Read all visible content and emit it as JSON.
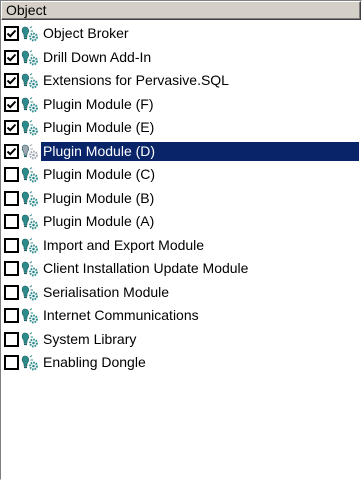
{
  "header": {
    "title": "Object"
  },
  "items": [
    {
      "label": "Object Broker",
      "checked": true,
      "selected": false
    },
    {
      "label": "Drill Down Add-In",
      "checked": true,
      "selected": false
    },
    {
      "label": "Extensions for Pervasive.SQL",
      "checked": true,
      "selected": false
    },
    {
      "label": "Plugin Module (F)",
      "checked": true,
      "selected": false
    },
    {
      "label": "Plugin Module (E)",
      "checked": true,
      "selected": false
    },
    {
      "label": "Plugin Module (D)",
      "checked": true,
      "selected": true
    },
    {
      "label": "Plugin Module (C)",
      "checked": false,
      "selected": false
    },
    {
      "label": "Plugin Module (B)",
      "checked": false,
      "selected": false
    },
    {
      "label": "Plugin Module (A)",
      "checked": false,
      "selected": false
    },
    {
      "label": "Import and Export Module",
      "checked": false,
      "selected": false
    },
    {
      "label": "Client Installation Update Module",
      "checked": false,
      "selected": false
    },
    {
      "label": "Serialisation Module",
      "checked": false,
      "selected": false
    },
    {
      "label": "Internet Communications",
      "checked": false,
      "selected": false
    },
    {
      "label": "System Library",
      "checked": false,
      "selected": false
    },
    {
      "label": "Enabling Dongle",
      "checked": false,
      "selected": false
    }
  ],
  "colors": {
    "selection_bg": "#0a246a",
    "selection_text": "#ffffff",
    "header_bg": "#d4d0c8",
    "icon_color": "#2e8b8b",
    "icon_color_selected": "#9fa7b4"
  },
  "icons": {
    "item": "bulb-gear-icon",
    "checkbox": "checkmark-icon"
  }
}
